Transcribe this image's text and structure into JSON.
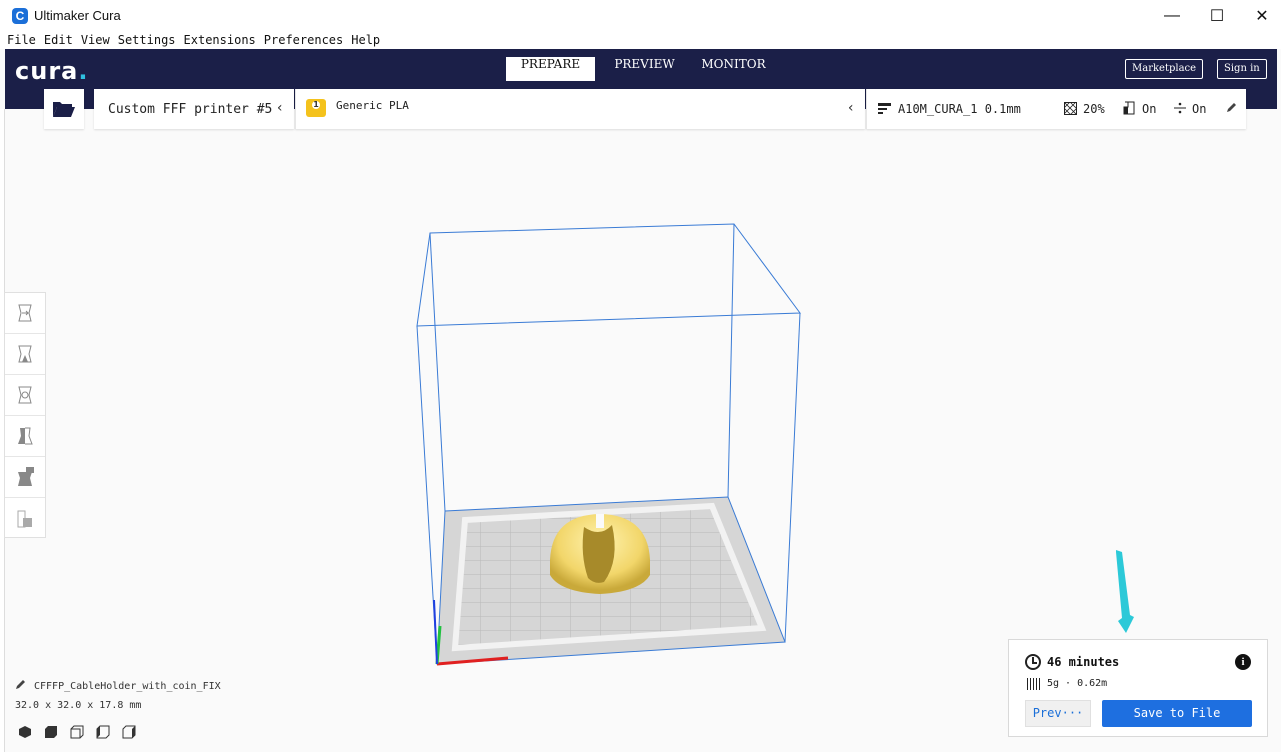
{
  "window": {
    "title": "Ultimaker Cura",
    "logo_letter": "C",
    "minimize": "—",
    "maximize": "☐",
    "close": "✕"
  },
  "menu": [
    "File",
    "Edit",
    "View",
    "Settings",
    "Extensions",
    "Preferences",
    "Help"
  ],
  "header": {
    "logo_text": "cura",
    "logo_dot": ".",
    "tabs": [
      "PREPARE",
      "PREVIEW",
      "MONITOR"
    ],
    "active_tab": "PREPARE",
    "marketplace": "Marketplace",
    "sign_in": "Sign in"
  },
  "toolbar": {
    "printer": "Custom FFF printer #5",
    "material": "Generic PLA",
    "profile": "A10M_CURA_1 0.1mm",
    "infill": "20%",
    "support": "On",
    "adhesion": "On",
    "chevron": "‹"
  },
  "object": {
    "name": "CFFFP_CableHolder_with_coin_FIX",
    "dimensions": "32.0 x 32.0 x 17.8 mm"
  },
  "print": {
    "time": "46 minutes",
    "material": "5g · 0.62m",
    "preview_label": "Prev···",
    "save_label": "Save to File"
  },
  "colors": {
    "header_bg": "#1b1f48",
    "accent_blue": "#1e6fe0",
    "model_yellow": "#f7e27a",
    "arrow_cyan": "#2cc9d8",
    "build_volume_blue": "#3a7bd5"
  }
}
